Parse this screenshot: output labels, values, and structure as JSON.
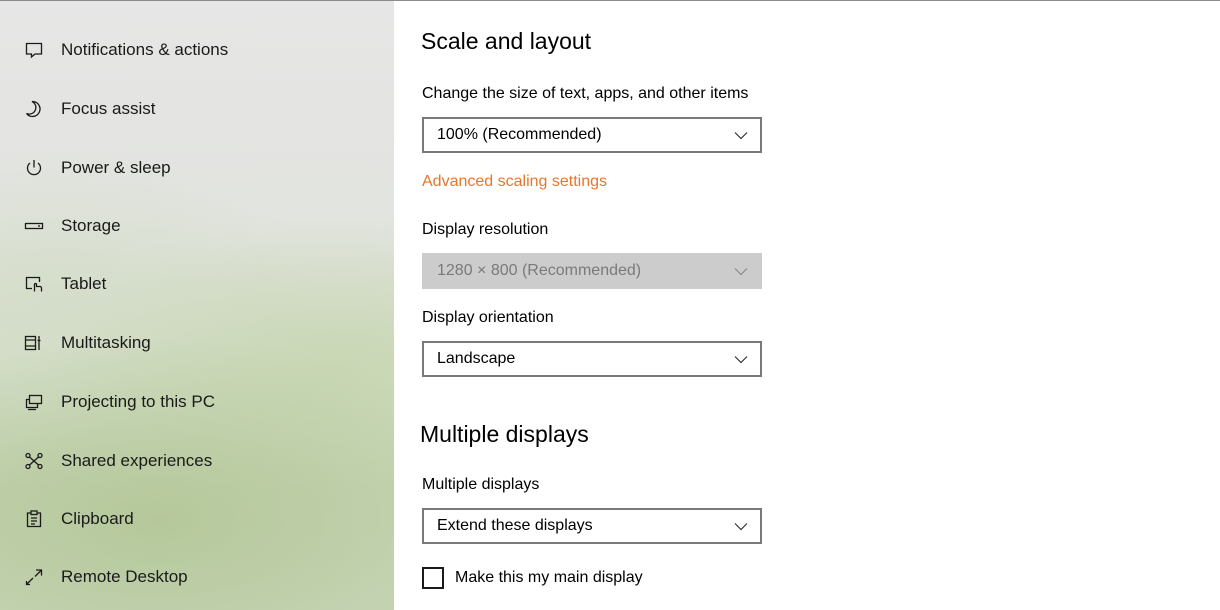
{
  "sidebar": {
    "items": [
      {
        "label": "Notifications & actions",
        "icon": "notification-icon"
      },
      {
        "label": "Focus assist",
        "icon": "moon-icon"
      },
      {
        "label": "Power & sleep",
        "icon": "power-icon"
      },
      {
        "label": "Storage",
        "icon": "storage-icon"
      },
      {
        "label": "Tablet",
        "icon": "tablet-icon"
      },
      {
        "label": "Multitasking",
        "icon": "multitasking-icon"
      },
      {
        "label": "Projecting to this PC",
        "icon": "projecting-icon"
      },
      {
        "label": "Shared experiences",
        "icon": "shared-experiences-icon"
      },
      {
        "label": "Clipboard",
        "icon": "clipboard-icon"
      },
      {
        "label": "Remote Desktop",
        "icon": "remote-desktop-icon"
      }
    ]
  },
  "main": {
    "scale_section": {
      "title": "Scale and layout",
      "size_label": "Change the size of text, apps, and other items",
      "size_value": "100% (Recommended)",
      "advanced_link": "Advanced scaling settings",
      "resolution_label": "Display resolution",
      "resolution_value": "1280 × 800 (Recommended)",
      "orientation_label": "Display orientation",
      "orientation_value": "Landscape"
    },
    "multiple_section": {
      "title": "Multiple displays",
      "multiple_label": "Multiple displays",
      "multiple_value": "Extend these displays",
      "main_display_label": "Make this my main display",
      "main_display_checked": false
    }
  },
  "colors": {
    "accent_link": "#e8762c",
    "disabled_dropdown": "#cccccc"
  }
}
